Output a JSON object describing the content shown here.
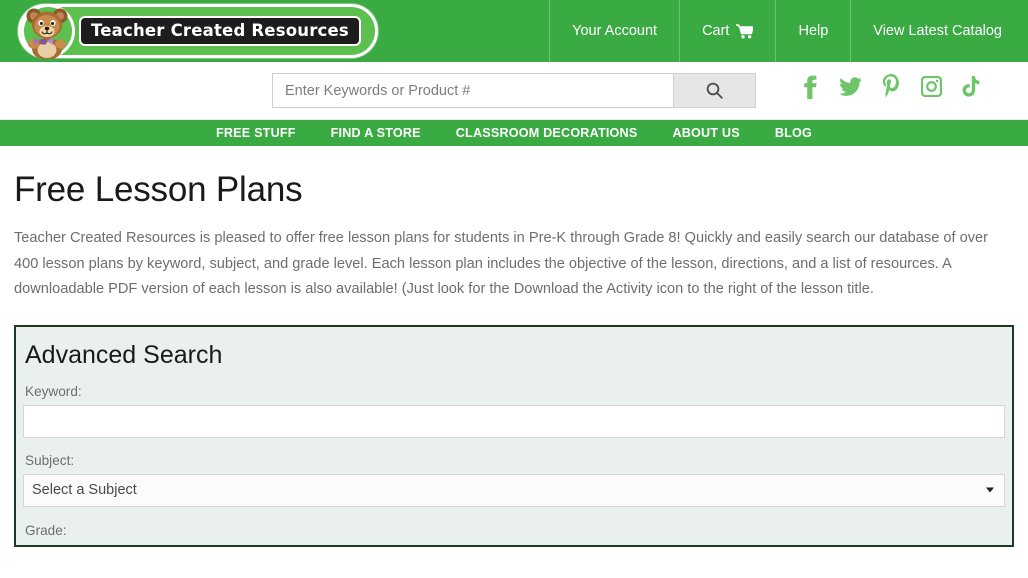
{
  "header": {
    "logo": {
      "brand_text": "Teacher Created Resources",
      "bear_icon": "teddy-bear-icon"
    },
    "nav": [
      {
        "label": "Your Account",
        "icon": null
      },
      {
        "label": "Cart",
        "icon": "shopping-cart-icon"
      },
      {
        "label": "Help",
        "icon": null
      },
      {
        "label": "View Latest Catalog",
        "icon": null
      }
    ]
  },
  "search": {
    "placeholder": "Enter Keywords or Product #",
    "value": "",
    "button_icon": "search-icon"
  },
  "social": [
    {
      "name": "facebook-icon",
      "label": "Facebook"
    },
    {
      "name": "twitter-icon",
      "label": "Twitter"
    },
    {
      "name": "pinterest-icon",
      "label": "Pinterest"
    },
    {
      "name": "instagram-icon",
      "label": "Instagram"
    },
    {
      "name": "tiktok-icon",
      "label": "TikTok"
    }
  ],
  "main_nav": [
    {
      "label": "FREE STUFF"
    },
    {
      "label": "FIND A STORE"
    },
    {
      "label": "CLASSROOM DECORATIONS"
    },
    {
      "label": "ABOUT US"
    },
    {
      "label": "BLOG"
    }
  ],
  "page": {
    "title": "Free Lesson Plans",
    "description": "Teacher Created Resources is pleased to offer free lesson plans for students in Pre-K through Grade 8! Quickly and easily search our database of over 400 lesson plans by keyword, subject, and grade level. Each lesson plan includes the objective of the lesson, directions, and a list of resources. A downloadable PDF version of each lesson is also available! (Just look for the Download the Activity icon to the right of the lesson title."
  },
  "advanced_search": {
    "title": "Advanced Search",
    "keyword": {
      "label": "Keyword:",
      "value": "",
      "placeholder": ""
    },
    "subject": {
      "label": "Subject:",
      "selected": "Select a Subject"
    },
    "grade": {
      "label": "Grade:"
    }
  },
  "colors": {
    "brand_green": "#3aaa42",
    "logo_badge_green": "#5cc04f",
    "social_green": "#6ec56a",
    "panel_bg": "#eaf0ee",
    "panel_border": "#1c3a22"
  }
}
